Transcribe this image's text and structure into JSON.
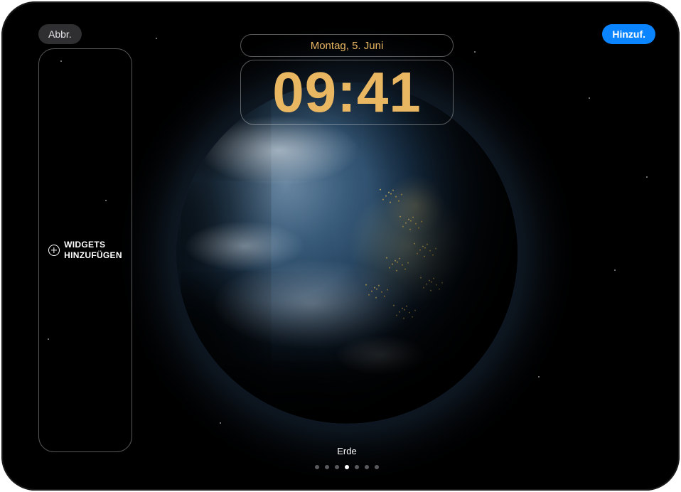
{
  "header": {
    "cancel_label": "Abbr.",
    "add_label": "Hinzuf."
  },
  "clock": {
    "date": "Montag, 5. Juni",
    "time": "09:41"
  },
  "widgets": {
    "add_label": "WIDGETS\nHINZUFÜGEN"
  },
  "wallpaper": {
    "name": "Erde"
  },
  "pager": {
    "count": 7,
    "active_index": 3
  },
  "colors": {
    "accent_time": "#e9b661",
    "add_button": "#0a84ff"
  }
}
